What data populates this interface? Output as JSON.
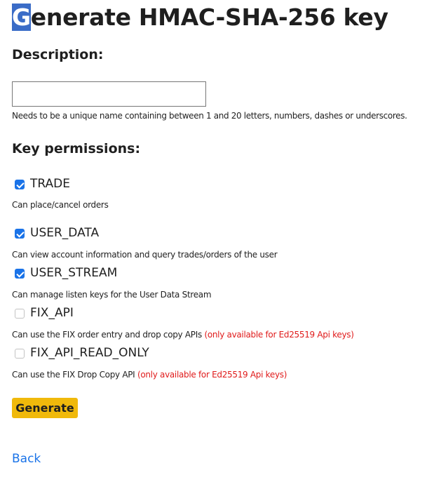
{
  "title": {
    "first_letter": "G",
    "rest": "enerate HMAC-SHA-256 key"
  },
  "description": {
    "heading": "Description:",
    "input_value": "",
    "hint": "Needs to be a unique name containing between 1 and 20 letters, numbers, dashes or underscores."
  },
  "permissions": {
    "heading": "Key permissions:",
    "items": [
      {
        "name": "TRADE",
        "checked": true,
        "description": "Can place/cancel orders",
        "note": ""
      },
      {
        "name": "USER_DATA",
        "checked": true,
        "description": "Can view account information and query trades/orders of the user",
        "note": ""
      },
      {
        "name": "USER_STREAM",
        "checked": true,
        "description": "Can manage listen keys for the User Data Stream",
        "note": ""
      },
      {
        "name": "FIX_API",
        "checked": false,
        "disabled": true,
        "description": "Can use the FIX order entry and drop copy APIs",
        "note": "(only available for Ed25519 Api keys)"
      },
      {
        "name": "FIX_API_READ_ONLY",
        "checked": false,
        "disabled": true,
        "description": "Can use the FIX Drop Copy API",
        "note": "(only available for Ed25519 Api keys)"
      }
    ]
  },
  "actions": {
    "generate_label": "Generate",
    "back_label": "Back"
  },
  "colors": {
    "button_bg": "#f0b90b",
    "link": "#1a73e8",
    "note": "#e01b1b",
    "checkbox_on": "#1a73e8",
    "selection": "#3a6cc7"
  }
}
